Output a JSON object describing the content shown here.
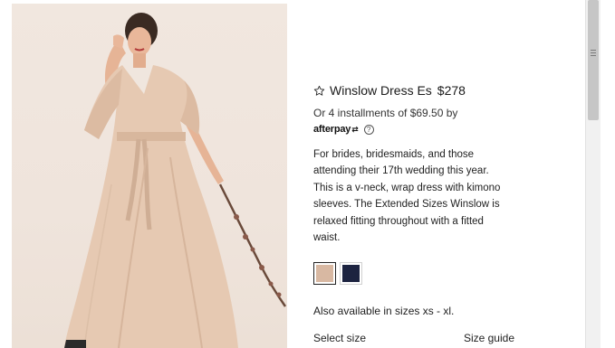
{
  "product": {
    "title": "Winslow Dress Es",
    "price": "$278",
    "installments_text": "Or 4 installments of $69.50 by",
    "afterpay_logo": "afterpay",
    "afterpay_arrows": "⇄",
    "help_symbol": "?",
    "description": "For brides, bridesmaids, and those attending their 17th wedding this year. This is a v-neck, wrap dress with kimono sleeves. The Extended Sizes Winslow is relaxed fitting throughout with a fitted waist.",
    "swatches": [
      {
        "color": "#d8b8a2",
        "selected": true
      },
      {
        "color": "#1c2340",
        "selected": false
      }
    ],
    "sizes_note": "Also available in sizes xs - xl.",
    "select_size_label": "Select size",
    "size_guide_label": "Size guide"
  },
  "icons": {
    "favorite": "star-icon",
    "help": "question-circle-icon"
  },
  "colors": {
    "dress": "#e6c9b2",
    "background": "#efe4dc",
    "scrollbar_thumb": "#c6c6c6"
  }
}
